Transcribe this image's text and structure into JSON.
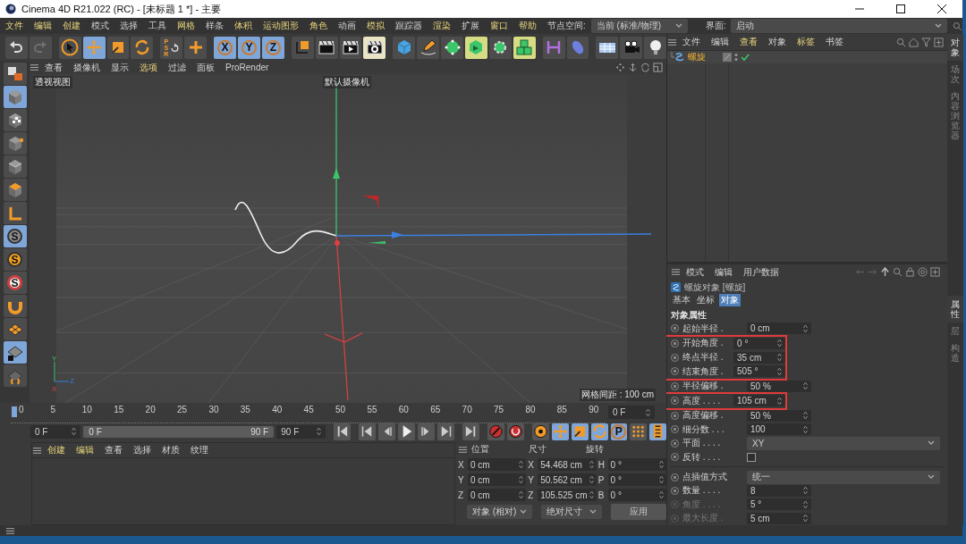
{
  "window": {
    "title": "Cinema 4D R21.022 (RC) - [未标题 1 *] - 主要"
  },
  "menu": [
    {
      "label": "文件",
      "highlighted": true
    },
    {
      "label": "编辑",
      "highlighted": true
    },
    {
      "label": "创建",
      "highlighted": true
    },
    {
      "label": "模式",
      "highlighted": false
    },
    {
      "label": "选择",
      "highlighted": false
    },
    {
      "label": "工具",
      "highlighted": false
    },
    {
      "label": "网格",
      "highlighted": true
    },
    {
      "label": "样条",
      "highlighted": false
    },
    {
      "label": "体积",
      "highlighted": true
    },
    {
      "label": "运动图形",
      "highlighted": true
    },
    {
      "label": "角色",
      "highlighted": true
    },
    {
      "label": "动画",
      "highlighted": false
    },
    {
      "label": "模拟",
      "highlighted": true
    },
    {
      "label": "跟踪器",
      "highlighted": false
    },
    {
      "label": "渲染",
      "highlighted": true
    },
    {
      "label": "扩展",
      "highlighted": false
    },
    {
      "label": "窗口",
      "highlighted": true
    },
    {
      "label": "帮助",
      "highlighted": true
    }
  ],
  "node_space": {
    "label": "节点空间:",
    "value": "当前 (标准/物理)"
  },
  "layout": {
    "label": "界面:",
    "value": "启动"
  },
  "toolbar": [
    {
      "kind": "undo",
      "selected": false
    },
    {
      "kind": "redo",
      "selected": false
    },
    {
      "kind": "cursor",
      "selected": false
    },
    {
      "kind": "move",
      "selected": true
    },
    {
      "kind": "scale",
      "selected": false
    },
    {
      "kind": "rotate",
      "selected": false
    },
    {
      "kind": "reset",
      "label": "PSR",
      "selected": false
    },
    {
      "kind": "plus",
      "selected": false
    },
    {
      "kind": "letter",
      "label": "X",
      "selected": true
    },
    {
      "kind": "letter",
      "label": "Y",
      "selected": true
    },
    {
      "kind": "letter",
      "label": "Z",
      "selected": true
    },
    {
      "kind": "axes",
      "selected": false
    },
    {
      "kind": "clapper",
      "selected": false
    },
    {
      "kind": "render",
      "selected": false
    },
    {
      "kind": "rendersettings",
      "selected": true,
      "color": "#e8e4c4"
    },
    {
      "kind": "cube",
      "selected": false
    },
    {
      "kind": "pen",
      "selected": false
    },
    {
      "kind": "sphere",
      "selected": false
    },
    {
      "kind": "cubearrow",
      "selected": true,
      "color": "#d6dc84"
    },
    {
      "kind": "gear",
      "selected": false
    },
    {
      "kind": "cubes",
      "selected": true,
      "color": "#d6dc84"
    },
    {
      "kind": "bracket",
      "selected": false
    },
    {
      "kind": "ellipsoid",
      "selected": false
    },
    {
      "kind": "floor",
      "selected": false
    },
    {
      "kind": "camera",
      "selected": false
    },
    {
      "kind": "bulb",
      "selected": false
    }
  ],
  "left_toolbar": [
    {
      "kind": "viewcube",
      "selected": false
    },
    {
      "kind": "model",
      "selected": true
    },
    {
      "kind": "texture",
      "selected": false
    },
    {
      "kind": "points",
      "selected": false
    },
    {
      "kind": "edges",
      "selected": false
    },
    {
      "kind": "polygons",
      "selected": false
    },
    {
      "kind": "axisl",
      "selected": false
    },
    {
      "kind": "snapgray",
      "label": "S",
      "selected": true
    },
    {
      "kind": "snaporange",
      "label": "S",
      "selected": false
    },
    {
      "kind": "snapring",
      "label": "S",
      "selected": false
    },
    {
      "kind": "magnet",
      "selected": false
    },
    {
      "kind": "grid",
      "selected": false
    },
    {
      "kind": "gridlock",
      "selected": true
    },
    {
      "kind": "workplane",
      "selected": false
    }
  ],
  "viewport": {
    "menu": [
      {
        "label": "查看",
        "highlighted": false
      },
      {
        "label": "摄像机",
        "highlighted": false
      },
      {
        "label": "显示",
        "highlighted": false
      },
      {
        "label": "选项",
        "highlighted": true
      },
      {
        "label": "过滤",
        "highlighted": false
      },
      {
        "label": "面板",
        "highlighted": false
      },
      {
        "label": "ProRender",
        "highlighted": false
      }
    ],
    "view_name": "透视视图",
    "camera": "默认摄像机",
    "grid_spacing": "网格间距 : 100 cm",
    "gizmo_labels": [
      "Y",
      "Z",
      "X"
    ]
  },
  "timeline": {
    "ticks": [
      "0",
      "5",
      "10",
      "15",
      "20",
      "25",
      "30",
      "35",
      "40",
      "45",
      "50",
      "55",
      "60",
      "65",
      "70",
      "75",
      "80",
      "85",
      "90"
    ],
    "current": "0 F",
    "start": "0 F",
    "range": {
      "start": "0 F",
      "end": "90 F",
      "level": 1
    },
    "end": "90 F"
  },
  "transport": [
    {
      "kind": "first",
      "selected": false
    },
    {
      "kind": "keyprev",
      "selected": false
    },
    {
      "kind": "frameprev",
      "selected": false
    },
    {
      "kind": "play",
      "selected": false
    },
    {
      "kind": "framenext",
      "selected": false
    },
    {
      "kind": "keynext",
      "selected": false
    },
    {
      "kind": "last",
      "selected": false
    },
    {
      "kind": "record",
      "selected": false
    },
    {
      "kind": "autokey",
      "selected": false
    },
    {
      "kind": "keyframe",
      "selected": false
    },
    {
      "kind": "move",
      "selected": true
    },
    {
      "kind": "scale",
      "selected": true
    },
    {
      "kind": "rotate",
      "selected": true
    },
    {
      "kind": "letter",
      "label": "P",
      "selected": true
    },
    {
      "kind": "dots",
      "selected": false
    },
    {
      "kind": "film",
      "selected": true
    }
  ],
  "material_manager": {
    "menu": [
      {
        "label": "创建",
        "highlighted": true
      },
      {
        "label": "编辑",
        "highlighted": true
      },
      {
        "label": "查看",
        "highlighted": false
      },
      {
        "label": "选择",
        "highlighted": false
      },
      {
        "label": "材质",
        "highlighted": false
      },
      {
        "label": "纹理",
        "highlighted": false
      }
    ]
  },
  "coordinates": {
    "headers": [
      "位置",
      "尺寸",
      "旋转"
    ],
    "rows": [
      {
        "pos_axis": "X",
        "pos": "0 cm",
        "size_axis": "X",
        "size": "54.468 cm",
        "rot_axis": "H",
        "rot": "0 °"
      },
      {
        "pos_axis": "Y",
        "pos": "0 cm",
        "size_axis": "Y",
        "size": "50.562 cm",
        "rot_axis": "P",
        "rot": "0 °"
      },
      {
        "pos_axis": "Z",
        "pos": "0 cm",
        "size_axis": "Z",
        "size": "105.525 cm",
        "rot_axis": "B",
        "rot": "0 °"
      }
    ],
    "mode": "对象 (相对)",
    "size_mode": "绝对尺寸",
    "apply": "应用"
  },
  "object_manager": {
    "menu": [
      {
        "label": "文件",
        "highlighted": false
      },
      {
        "label": "编辑",
        "highlighted": false
      },
      {
        "label": "查看",
        "highlighted": true
      },
      {
        "label": "对象",
        "highlighted": false
      },
      {
        "label": "标签",
        "highlighted": true
      },
      {
        "label": "书签",
        "highlighted": false
      }
    ],
    "objects": [
      {
        "name": "螺旋",
        "enabled": true
      }
    ]
  },
  "attributes": {
    "menu": [
      {
        "label": "模式",
        "highlighted": false
      },
      {
        "label": "编辑",
        "highlighted": false
      },
      {
        "label": "用户数据",
        "highlighted": false
      }
    ],
    "object_title": "螺旋对象 [螺旋]",
    "tabs": [
      {
        "label": "基本",
        "selected": false
      },
      {
        "label": "坐标",
        "selected": false
      },
      {
        "label": "对象",
        "selected": true
      }
    ],
    "section": "对象属性",
    "params": [
      {
        "kind": "number",
        "label": "起始半径 .",
        "value": "0 cm"
      },
      {
        "kind": "highlight",
        "rows": [
          {
            "kind": "number",
            "label": "开始角度 .",
            "value": "0 °"
          },
          {
            "kind": "number",
            "label": "终点半径 .",
            "value": "35 cm"
          },
          {
            "kind": "number",
            "label": "结束角度 .",
            "value": "505 °"
          }
        ]
      },
      {
        "kind": "number",
        "label": "半径偏移 .",
        "value": "50 %"
      },
      {
        "kind": "highlight",
        "rows": [
          {
            "kind": "number",
            "label": "高度 . . . .",
            "value": "105 cm"
          }
        ]
      },
      {
        "kind": "number",
        "label": "高度偏移 .",
        "value": "50 %"
      },
      {
        "kind": "number",
        "label": "细分数 . . .",
        "value": "100"
      },
      {
        "kind": "dropdown",
        "label": "平面 . . . .",
        "value": "XY"
      },
      {
        "kind": "checkbox",
        "label": "反转 . . . .",
        "checked": false
      }
    ],
    "interpolation": [
      {
        "kind": "dropdown",
        "label": "点插值方式",
        "value": "统一",
        "disabled": false
      },
      {
        "kind": "number",
        "label": "数量 . . . .",
        "value": "8",
        "disabled": false
      },
      {
        "kind": "number",
        "label": "角度 . . . .",
        "value": "5 °",
        "disabled": true
      },
      {
        "kind": "number",
        "label": "最大长度 .",
        "value": "5 cm",
        "disabled": true
      }
    ]
  },
  "side_tabs_top": [
    {
      "label": "对象",
      "selected": true
    },
    {
      "label": "场次",
      "selected": false
    },
    {
      "label": "内容浏览器",
      "selected": false
    }
  ],
  "side_tabs_bottom": [
    {
      "label": "属性",
      "selected": true
    },
    {
      "label": "层",
      "selected": false
    },
    {
      "label": "构造",
      "selected": false
    }
  ]
}
